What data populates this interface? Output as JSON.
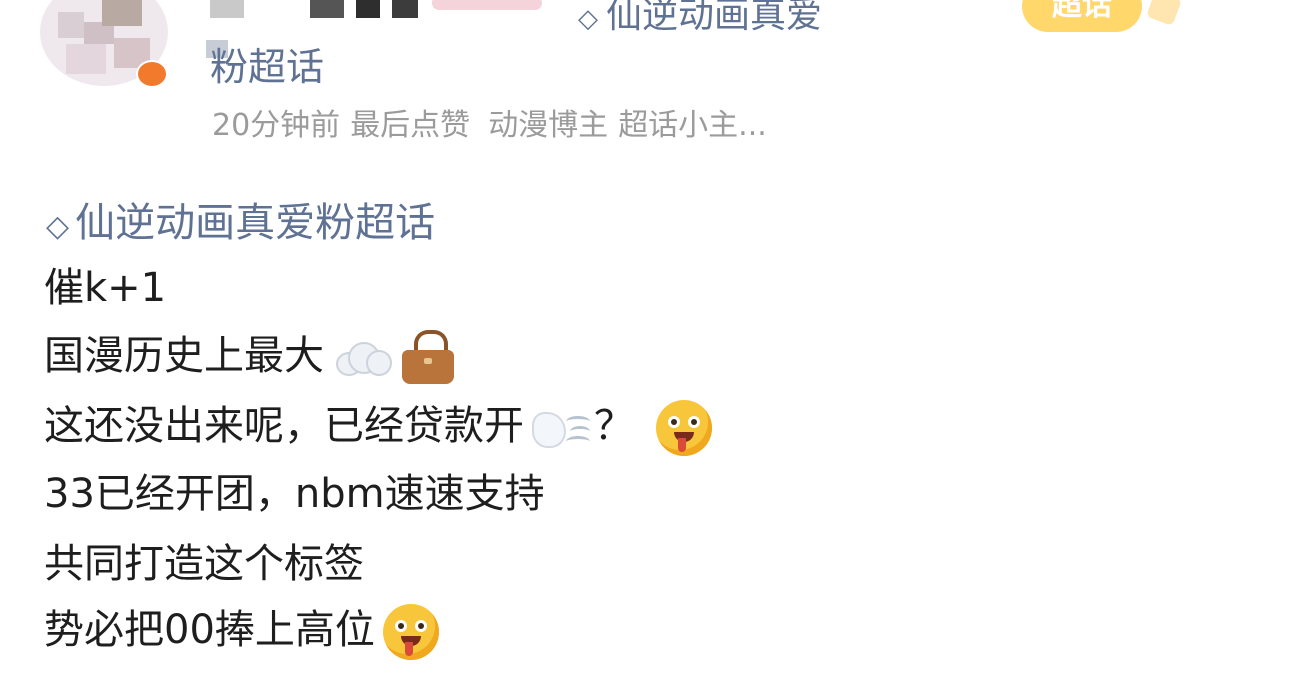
{
  "header": {
    "topic_top": "仙逆动画真爱",
    "topic_cont": "粉超话",
    "chaohua_badge": "超话",
    "meta": {
      "time": "20分钟前",
      "last_like": "最后点赞",
      "tag1": "动漫博主",
      "tag2": "超话小主..."
    }
  },
  "post": {
    "topic": "仙逆动画真爱粉超话",
    "lines": {
      "l1": "催k+1",
      "l2": "国漫历史上最大",
      "l3": "这还没出来呢，已经贷款开",
      "l3_suffix": "？",
      "l4": "33已经开团，nbm速速支持",
      "l5": "共同打造这个标签",
      "l6": "势必把00捧上高位"
    }
  },
  "icons": {
    "topic_icon": "diamond-icon",
    "cloud": "cloud-icon",
    "bag": "handbag-icon",
    "wind": "wind-blowing-face-icon",
    "drool": "drooling-face-icon"
  },
  "colors": {
    "topic_link": "#5f7294",
    "meta_text": "#9b9b9b",
    "body_text": "#1e1e1e",
    "badge": "#ffd76a",
    "avatar_badge": "#f17a2c"
  }
}
